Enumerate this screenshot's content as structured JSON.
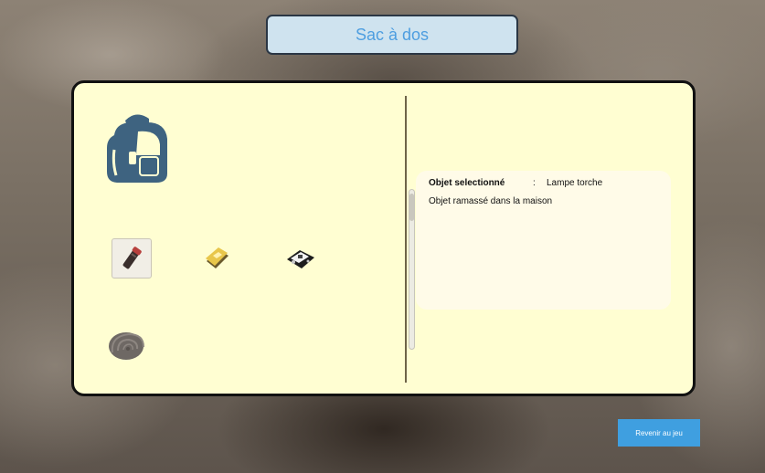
{
  "header": {
    "title": "Sac à dos"
  },
  "inventory": {
    "items": [
      {
        "icon": "flashlight-icon",
        "selected": true
      },
      {
        "icon": "book-icon",
        "selected": false
      },
      {
        "icon": "device-icon",
        "selected": false
      },
      {
        "icon": "ammonite-fossil-icon",
        "selected": false
      }
    ]
  },
  "details": {
    "selected_label": "Objet selectionné",
    "separator": ":",
    "selected_value": "Lampe torche",
    "description": "Objet ramassé dans la maison"
  },
  "footer": {
    "back_button_label": "Revenir au jeu"
  },
  "colors": {
    "panel_bg": "#fffed2",
    "title_bg": "#cfe3ef",
    "title_text": "#4e9ee0",
    "button_bg": "#3f9fe0",
    "backpack": "#3e6380"
  }
}
